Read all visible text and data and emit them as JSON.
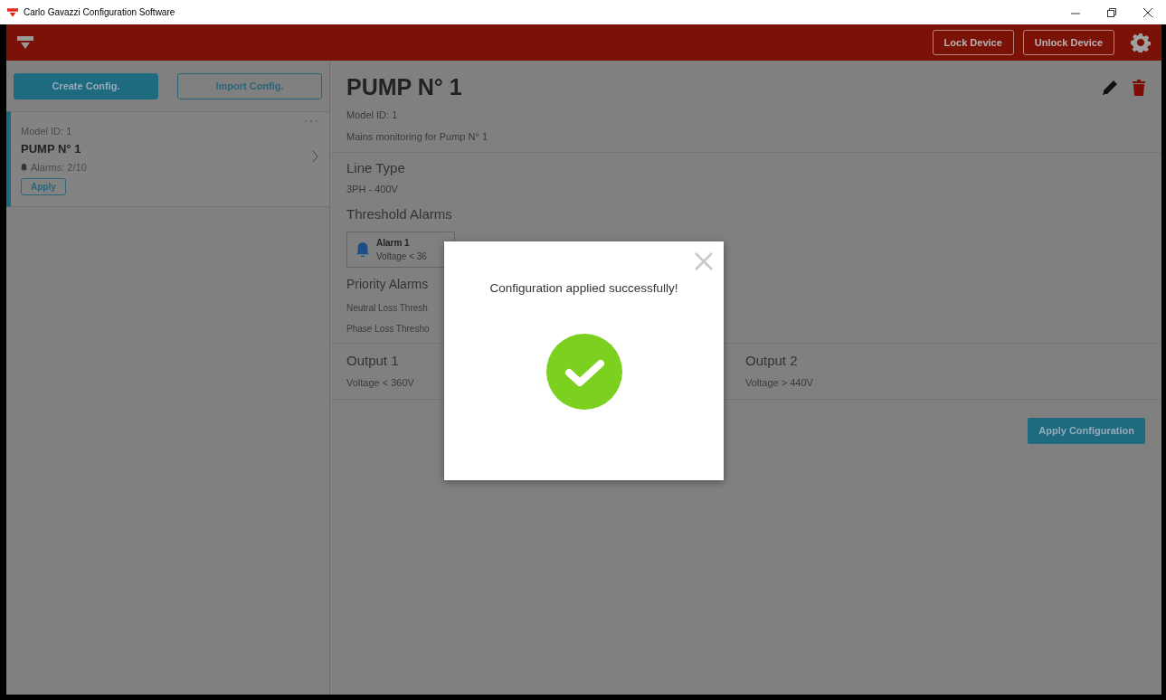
{
  "window": {
    "title": "Carlo Gavazzi Configuration Software"
  },
  "header": {
    "buttons": [
      "Lock Device",
      "Unlock Device"
    ]
  },
  "sidebar": {
    "buttons": [
      "Create Config.",
      "Import Config."
    ],
    "items": [
      {
        "model_id": "Model ID: 1",
        "name": "PUMP N° 1",
        "alarms": "Alarms: 2/10",
        "action": "Apply",
        "selected": true
      }
    ]
  },
  "detail": {
    "title": "PUMP N° 1",
    "model_id": "Model ID: 1",
    "description": "Mains monitoring for Pump N° 1",
    "line_type": {
      "heading": "Line Type",
      "value": "3PH - 400V"
    },
    "threshold_alarms": {
      "heading": "Threshold Alarms",
      "alarms": [
        {
          "name": "Alarm 1",
          "condition": "Voltage < 36"
        }
      ]
    },
    "priority_alarms": {
      "heading": "Priority Alarms",
      "lines": [
        "Neutral Loss Thresh",
        "Phase Loss Thresho"
      ]
    },
    "outputs": [
      {
        "name": "Output 1",
        "condition": "Voltage < 360V"
      },
      {
        "name": "Output 2",
        "condition": "Voltage > 440V"
      }
    ],
    "apply_button": "Apply Configuration"
  },
  "modal": {
    "message": "Configuration applied successfully!"
  }
}
